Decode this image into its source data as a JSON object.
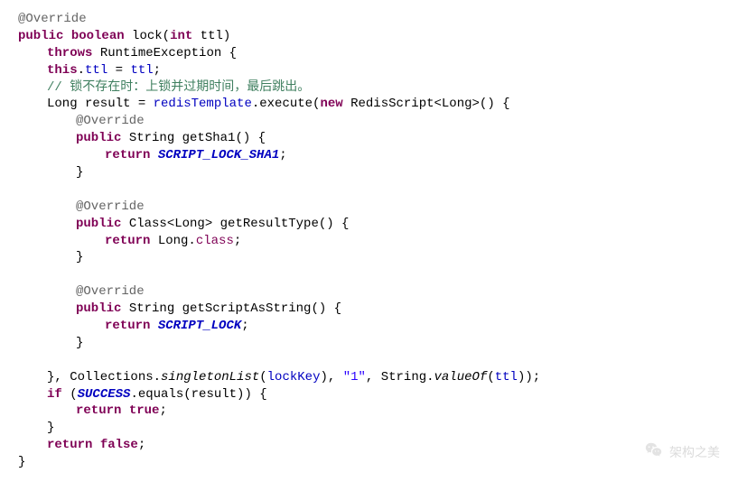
{
  "code": {
    "l1_ann": "@Override",
    "l2_kw1": "public",
    "l2_kw2": "boolean",
    "l2_name": " lock(",
    "l2_kw3": "int",
    "l2_rest": " ttl)",
    "l3_kw": "throws",
    "l3_rest": " RuntimeException {",
    "l4_kw": "this",
    "l4_dot": ".",
    "l4_fld1": "ttl",
    "l4_eq": " = ",
    "l4_fld2": "ttl",
    "l4_semi": ";",
    "l5_cmt": "// 锁不存在时：上锁并过期时间，最后跳出。",
    "l6a": "Long result = ",
    "l6_fld": "redisTemplate",
    "l6b": ".execute(",
    "l6_kw": "new",
    "l6c": " RedisScript<Long>() {",
    "l7_ann": "@Override",
    "l8_kw": "public",
    "l8_rest": " String getSha1() {",
    "l9_kw": "return",
    "l9_sp": " ",
    "l9_stc": "SCRIPT_LOCK_SHA1",
    "l9_semi": ";",
    "l10": "}",
    "l11": "",
    "l12_ann": "@Override",
    "l13_kw": "public",
    "l13_rest": " Class<Long> getResultType() {",
    "l14_kw": "return",
    "l14a": " Long.",
    "l14_kw2": "class",
    "l14_semi": ";",
    "l15": "}",
    "l16": "",
    "l17_ann": "@Override",
    "l18_kw": "public",
    "l18_rest": " String getScriptAsString() {",
    "l19_kw": "return",
    "l19_sp": " ",
    "l19_stc": "SCRIPT_LOCK",
    "l19_semi": ";",
    "l20": "}",
    "l21": "",
    "l22a": "}, Collections.",
    "l22_sm1": "singletonList",
    "l22b": "(",
    "l22_fld": "lockKey",
    "l22c": "), ",
    "l22_str": "\"1\"",
    "l22d": ", String.",
    "l22_sm2": "valueOf",
    "l22e": "(",
    "l22_fld2": "ttl",
    "l22f": "));",
    "l23_kw": "if",
    "l23a": " (",
    "l23_stc": "SUCCESS",
    "l23b": ".equals(result)) {",
    "l24_kw": "return",
    "l24_kw2": "true",
    "l24_semi": ";",
    "l25": "}",
    "l26_kw": "return",
    "l26_kw2": "false",
    "l26_semi": ";",
    "l27": "}"
  },
  "watermark": {
    "text": "架构之美"
  }
}
